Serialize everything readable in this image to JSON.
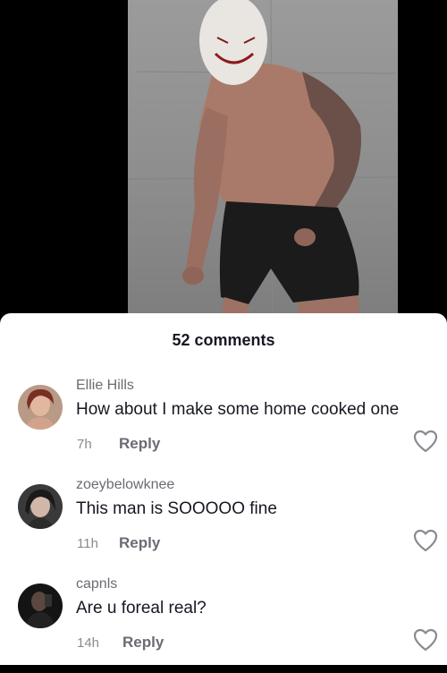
{
  "header": {
    "comment_count": "52 comments"
  },
  "comments": [
    {
      "username": "Ellie Hills",
      "text": "How about I make some home cooked one",
      "time": "7h",
      "reply_label": "Reply"
    },
    {
      "username": "zoeybelowknee",
      "text": "This man is SOOOOO fine",
      "time": "11h",
      "reply_label": "Reply"
    },
    {
      "username": "capnls",
      "text": "Are u foreal real?",
      "time": "14h",
      "reply_label": "Reply"
    }
  ],
  "icons": {
    "like": "heart-outline-icon"
  },
  "colors": {
    "sheet_bg": "#ffffff",
    "text_primary": "#161823",
    "text_secondary": "#8a8b91"
  }
}
